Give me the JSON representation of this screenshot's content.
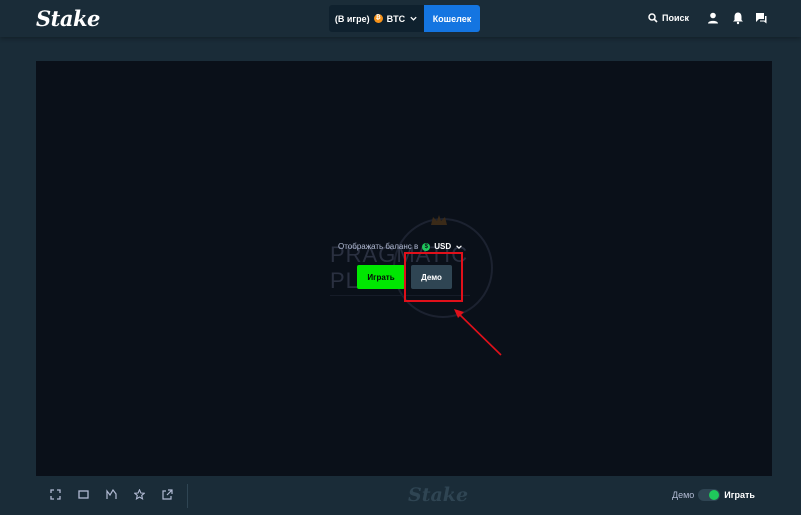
{
  "header": {
    "logo": "Stake",
    "balance_label": "(В игре)",
    "currency_code": "BTC",
    "wallet_label": "Кошелек",
    "search_label": "Поиск"
  },
  "game": {
    "watermark": "PRAGMATIC PLAY",
    "balance_prompt": "Отображать баланс в",
    "balance_currency": "USD",
    "play_label": "Играть",
    "demo_label": "Демо"
  },
  "toolbar": {
    "logo": "Stake",
    "mode_demo_label": "Демо",
    "mode_play_label": "Играть",
    "mode_real_active": true
  },
  "colors": {
    "background": "#1a2c38",
    "game_background": "#0a1019",
    "wallet_accent": "#1475e1",
    "play_green": "#00e701",
    "highlight_red": "#e0101a"
  },
  "icons": {
    "search": "search-icon",
    "profile": "user-icon",
    "notifications": "bell-icon",
    "chat": "chat-icon",
    "fullscreen": "fullscreen-icon",
    "theatre": "theatre-mode-icon",
    "stats": "stats-icon",
    "favourite": "star-icon",
    "popout": "popout-icon"
  }
}
